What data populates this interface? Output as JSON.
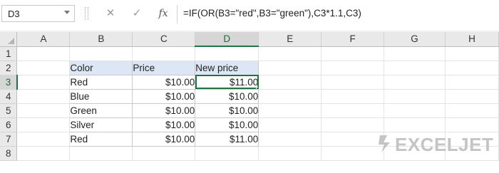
{
  "formula_bar": {
    "name_box": "D3",
    "cancel_icon": "close-icon",
    "enter_icon": "check-icon",
    "fx_label": "fx",
    "formula": "=IF(OR(B3=\"red\",B3=\"green\"),C3*1.1,C3)"
  },
  "sheet": {
    "columns": [
      "A",
      "B",
      "C",
      "D",
      "E",
      "F",
      "G",
      "H"
    ],
    "rows": [
      "1",
      "2",
      "3",
      "4",
      "5",
      "6",
      "7",
      "8"
    ],
    "active_cell": "D3",
    "table": {
      "headers": [
        "Color",
        "Price",
        "New price"
      ],
      "rows": [
        [
          "Red",
          "$10.00",
          "$11.00"
        ],
        [
          "Blue",
          "$10.00",
          "$10.00"
        ],
        [
          "Green",
          "$10.00",
          "$10.00"
        ],
        [
          "Silver",
          "$10.00",
          "$10.00"
        ],
        [
          "Red",
          "$10.00",
          "$11.00"
        ]
      ]
    }
  },
  "watermark": {
    "brand": "EXCELJET"
  },
  "colors": {
    "accent": "#217346",
    "table_header_fill": "#dce6f5",
    "grid_header_fill": "#e9e9e9"
  }
}
